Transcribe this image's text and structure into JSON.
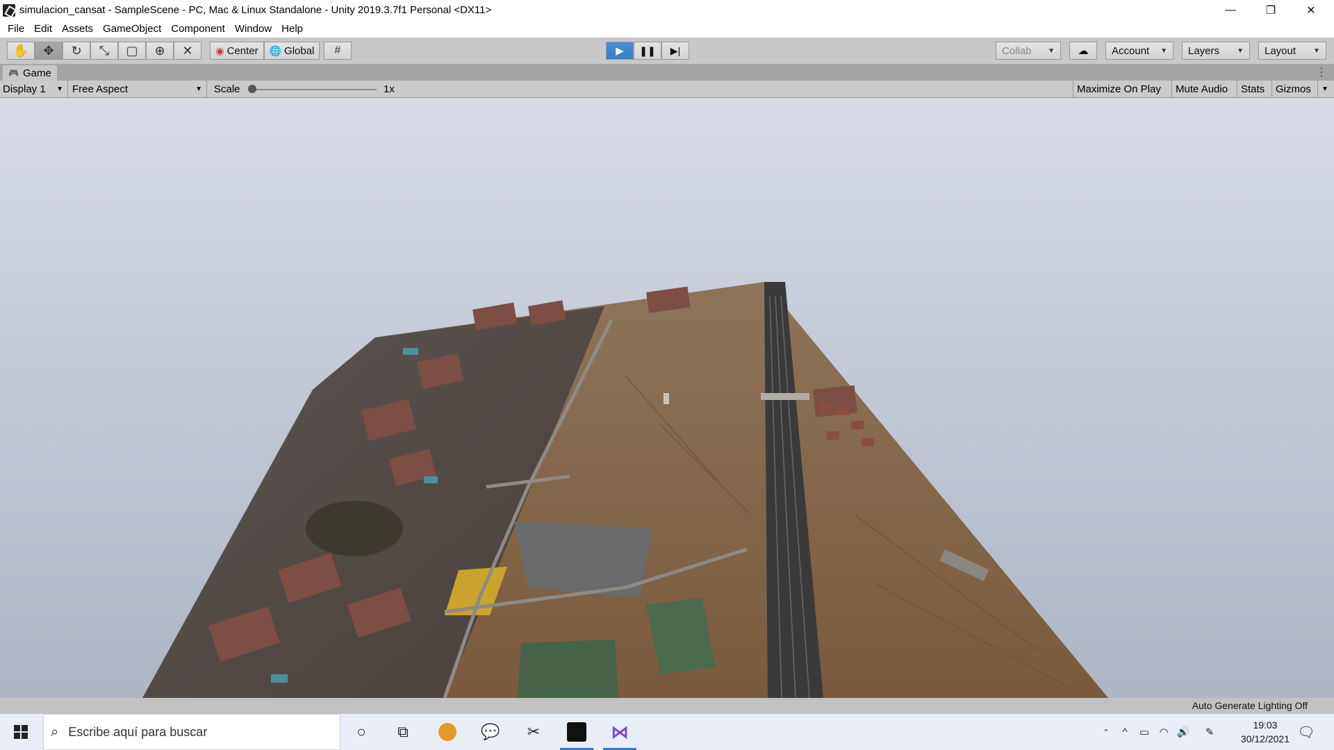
{
  "window": {
    "title": "simulacion_cansat - SampleScene - PC, Mac & Linux Standalone - Unity 2019.3.7f1 Personal <DX11>",
    "minimize": "—",
    "restore": "❐",
    "close": "✕"
  },
  "menu": [
    "File",
    "Edit",
    "Assets",
    "GameObject",
    "Component",
    "Window",
    "Help"
  ],
  "toolbar": {
    "center_label": "Center",
    "global_label": "Global",
    "collab_label": "Collab",
    "account_label": "Account",
    "layers_label": "Layers",
    "layout_label": "Layout"
  },
  "game_tab": {
    "label": "Game",
    "display": "Display 1",
    "aspect": "Free Aspect",
    "scale_label": "Scale",
    "scale_value": "1x",
    "scale_fraction": 0.0,
    "maximize": "Maximize On Play",
    "mute": "Mute Audio",
    "stats": "Stats",
    "gizmos": "Gizmos"
  },
  "status": {
    "text": "Auto Generate Lighting Off"
  },
  "taskbar": {
    "search_placeholder": "Escribe aquí para buscar",
    "time": "19:03",
    "date": "30/12/2021"
  },
  "colors": {
    "play_blue": "#3a7cc8",
    "taskbar_bg": "#e9eef6",
    "sky": "#c5ccd8",
    "terrain": "#8b6a4a"
  }
}
